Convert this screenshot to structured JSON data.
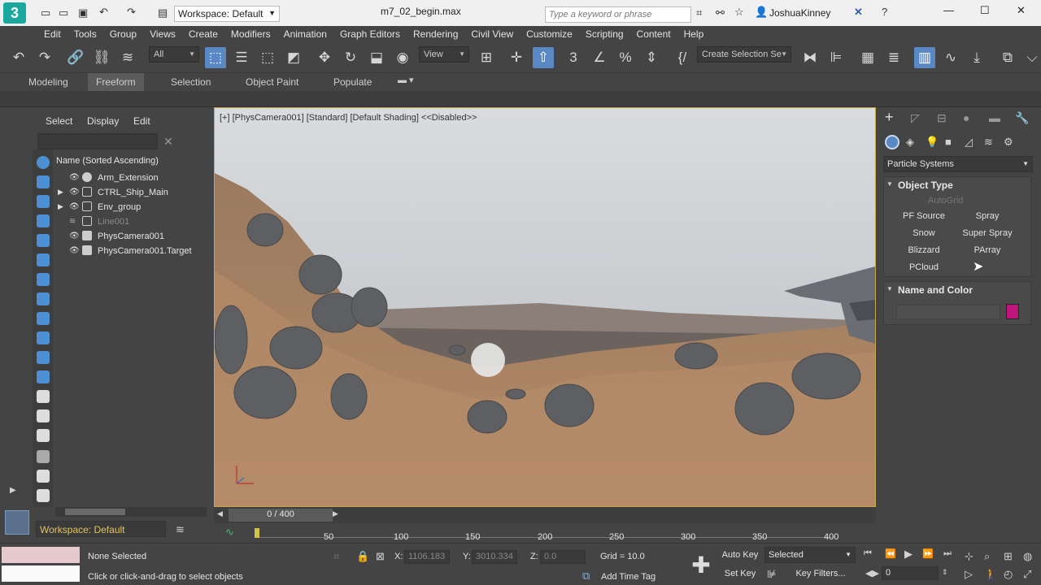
{
  "titlebar": {
    "workspace": "Workspace: Default",
    "file_name": "m7_02_begin.max",
    "search_placeholder": "Type a keyword or phrase",
    "username": "JoshuaKinney"
  },
  "menus": [
    "Edit",
    "Tools",
    "Group",
    "Views",
    "Create",
    "Modifiers",
    "Animation",
    "Graph Editors",
    "Rendering",
    "Civil View",
    "Customize",
    "Scripting",
    "Content",
    "Help"
  ],
  "toolbar": {
    "filter": "All",
    "ref_coord": "View",
    "selection_set": "Create Selection Se"
  },
  "ribbon_tabs": [
    "Modeling",
    "Freeform",
    "Selection",
    "Object Paint",
    "Populate"
  ],
  "scene_explorer": {
    "menus": [
      "Select",
      "Display",
      "Edit"
    ],
    "column_header": "Name (Sorted Ascending)",
    "items": [
      {
        "name": "Arm_Extension",
        "expandable": false,
        "dim": false
      },
      {
        "name": "CTRL_Ship_Main",
        "expandable": true,
        "dim": false
      },
      {
        "name": "Env_group",
        "expandable": true,
        "dim": false
      },
      {
        "name": "Line001",
        "expandable": false,
        "dim": true
      },
      {
        "name": "PhysCamera001",
        "expandable": false,
        "dim": false
      },
      {
        "name": "PhysCamera001.Target",
        "expandable": false,
        "dim": false
      }
    ],
    "workspace": "Workspace: Default"
  },
  "viewport": {
    "label": "[+] [PhysCamera001] [Standard] [Default Shading]  <<Disabled>>"
  },
  "command_panel": {
    "category": "Particle Systems",
    "object_type_header": "Object Type",
    "autogrid": "AutoGrid",
    "buttons": [
      "PF Source",
      "Spray",
      "Snow",
      "Super Spray",
      "Blizzard",
      "PArray",
      "PCloud"
    ],
    "name_color_header": "Name and Color",
    "swatch_color": "#c0157d"
  },
  "timeline": {
    "frame": "0 / 400",
    "ticks": [
      "50",
      "100",
      "150",
      "200",
      "250",
      "300",
      "350",
      "400"
    ]
  },
  "status": {
    "selection": "None Selected",
    "prompt": "Click or click-and-drag to select objects",
    "x_label": "X:",
    "x_value": "1106.183",
    "y_label": "Y:",
    "y_value": "3010.334",
    "z_label": "Z:",
    "z_value": "0.0",
    "grid": "Grid = 10.0",
    "add_time_tag": "Add Time Tag",
    "auto_key": "Auto Key",
    "set_key": "Set Key",
    "key_mode": "Selected",
    "key_filters": "Key Filters...",
    "current_frame": "0"
  }
}
